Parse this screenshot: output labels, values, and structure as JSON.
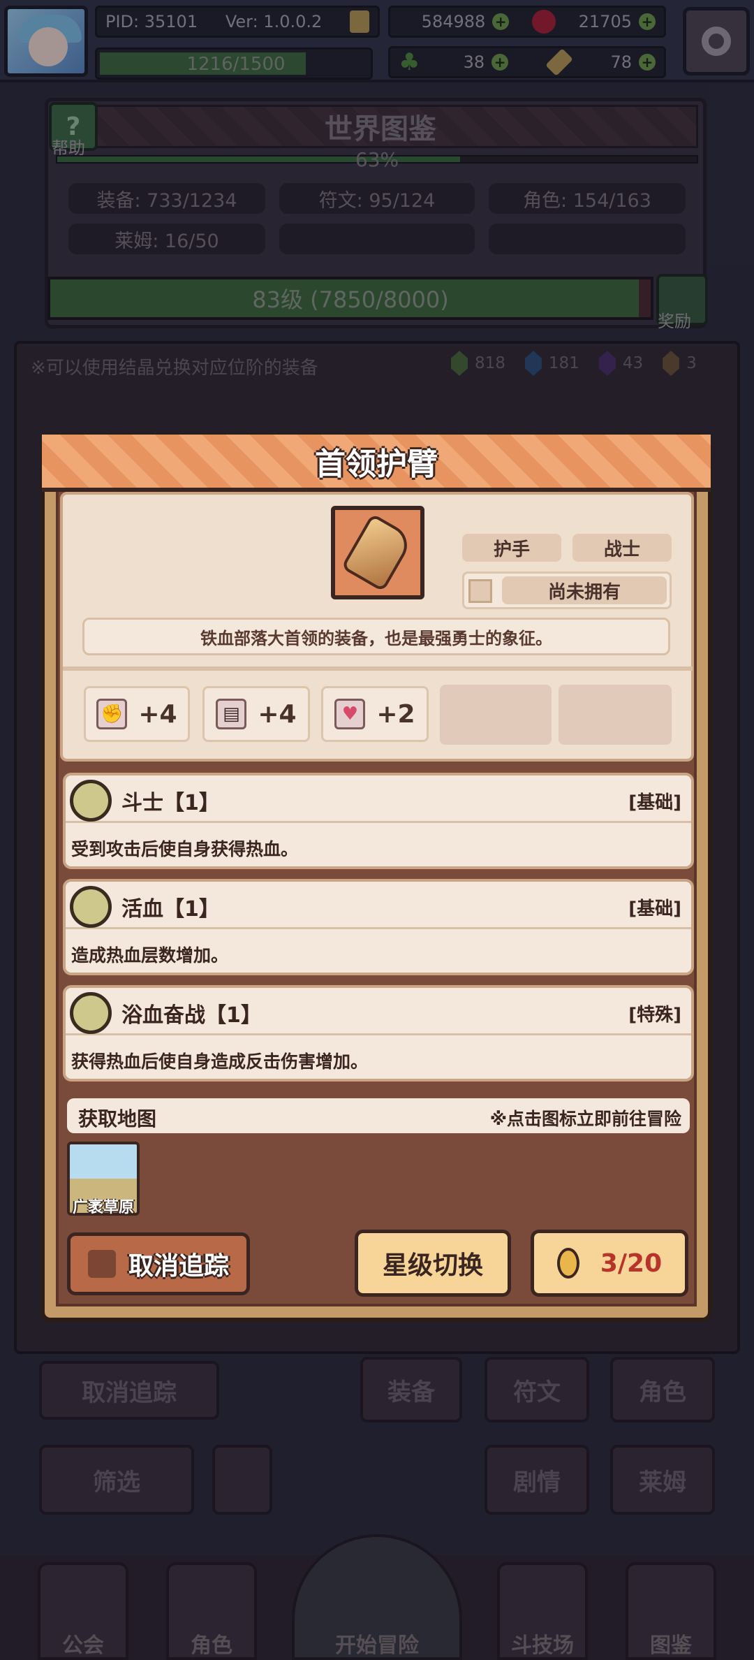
{
  "topbar": {
    "pid": "PID: 35101",
    "version": "Ver: 1.0.0.2",
    "exp": "1216/1500",
    "coins": "584988",
    "gems": "21705",
    "clovers": "38",
    "keys": "78"
  },
  "codex": {
    "help_label": "帮助",
    "title": "世界图鉴",
    "progress_percent": "63%",
    "progress_fraction": 0.63,
    "stats": [
      "装备: 733/1234",
      "符文: 95/124",
      "角色: 154/163",
      "莱姆: 16/50"
    ],
    "level_text": "83级 (7850/8000)",
    "level_fraction": 0.98,
    "reward_label": "奖励"
  },
  "hint": {
    "text": "※可以使用结晶兑换对应位阶的装备",
    "crystals": [
      {
        "count": "818",
        "color": "#4a6a3a"
      },
      {
        "count": "181",
        "color": "#2f4f7a"
      },
      {
        "count": "43",
        "color": "#4a2e6a"
      },
      {
        "count": "3",
        "color": "#6a553a"
      }
    ]
  },
  "background_buttons": {
    "untrack": "取消追踪",
    "equipment": "装备",
    "rune": "符文",
    "role": "角色",
    "filter": "筛选",
    "story": "剧情",
    "slime": "莱姆"
  },
  "modal": {
    "title": "首领护臂",
    "type_tag": "护手",
    "class_tag": "战士",
    "owned_status": "尚未拥有",
    "description": "铁血部落大首领的装备，也是最强勇士的象征。",
    "attributes": [
      {
        "icon": "fist-icon",
        "value": "+4"
      },
      {
        "icon": "book-icon",
        "value": "+4"
      },
      {
        "icon": "heart-icon",
        "value": "+2"
      }
    ],
    "skills": [
      {
        "name": "斗士【1】",
        "tag": "[基础]",
        "desc": "受到攻击后使自身获得热血。"
      },
      {
        "name": "活血【1】",
        "tag": "[基础]",
        "desc": "造成热血层数增加。"
      },
      {
        "name": "浴血奋战【1】",
        "tag": "[特殊]",
        "desc": "获得热血后使自身造成反击伤害增加。"
      }
    ],
    "map_section_title": "获取地图",
    "map_hint": "※点击图标立即前往冒险",
    "map_name": "广袤草原",
    "untrack_button": "取消追踪",
    "star_switch_button": "星级切换",
    "count_button": "3/20"
  },
  "nav": [
    "公会",
    "角色",
    "开始冒险",
    "斗技场",
    "图鉴"
  ]
}
